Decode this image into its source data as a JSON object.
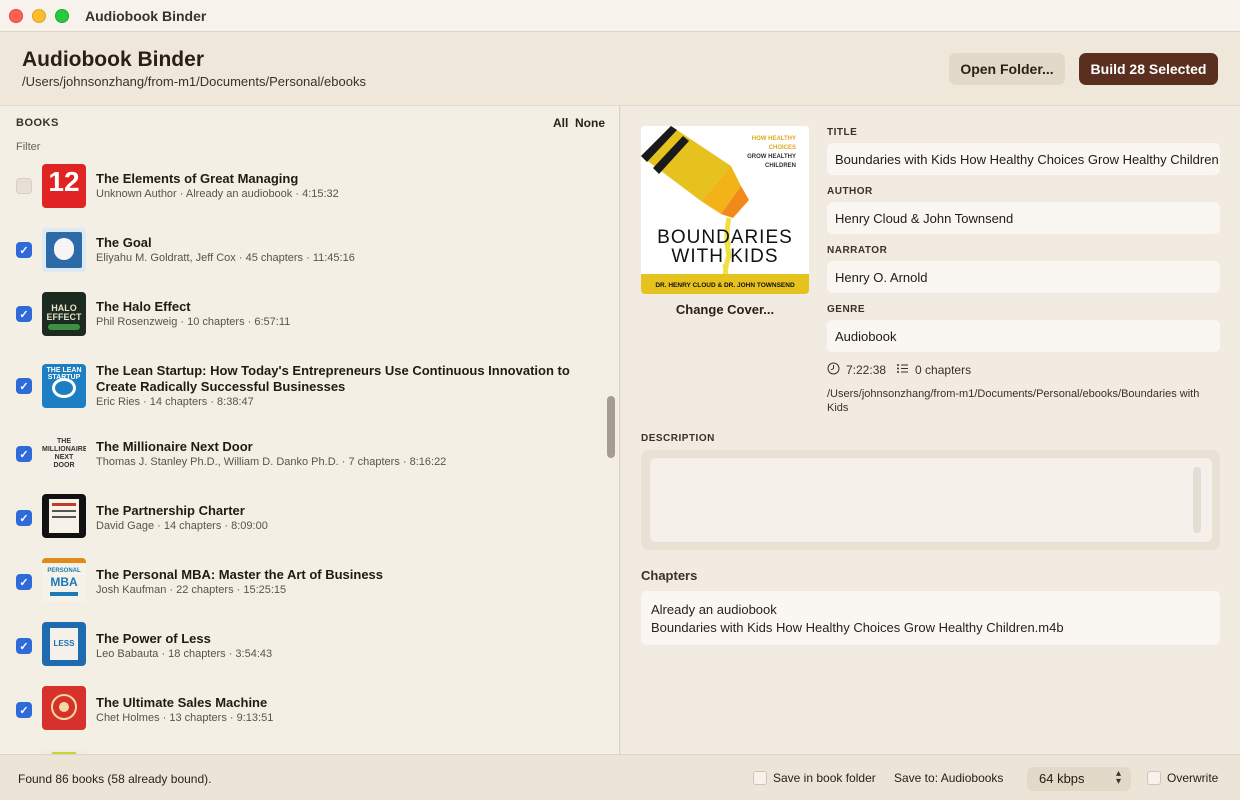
{
  "window": {
    "title": "Audiobook Binder"
  },
  "header": {
    "title": "Audiobook Binder",
    "path": "/Users/johnsonzhang/from-m1/Documents/Personal/ebooks",
    "open_folder_label": "Open Folder...",
    "build_label": "Build 28 Selected"
  },
  "books_panel": {
    "heading": "BOOKS",
    "all_label": "All",
    "none_label": "None",
    "filter_placeholder": "Filter",
    "items": [
      {
        "title": "The Elements of Great Managing",
        "meta": "Unknown Author  ·  Already an audiobook  ·  4:15:32",
        "checked": false
      },
      {
        "title": "The Goal",
        "meta": "Eliyahu M. Goldratt, Jeff Cox  ·  45 chapters  ·  11:45:16",
        "checked": true
      },
      {
        "title": "The Halo Effect",
        "meta": "Phil Rosenzweig  ·  10 chapters  ·  6:57:11",
        "checked": true
      },
      {
        "title": "The Lean Startup: How Today's Entrepreneurs Use Continuous Innovation to Create Radically Successful Businesses",
        "meta": "Eric Ries  ·  14 chapters  ·  8:38:47",
        "checked": true
      },
      {
        "title": "The Millionaire Next Door",
        "meta": "Thomas J. Stanley Ph.D., William D. Danko Ph.D.  ·  7 chapters  ·  8:16:22",
        "checked": true
      },
      {
        "title": "The Partnership Charter",
        "meta": "David Gage  ·  14 chapters  ·  8:09:00",
        "checked": true
      },
      {
        "title": "The Personal MBA: Master the Art of Business",
        "meta": "Josh Kaufman  ·  22 chapters  ·  15:25:15",
        "checked": true
      },
      {
        "title": "The Power of Less",
        "meta": "Leo Babauta  ·  18 chapters  ·  3:54:43",
        "checked": true
      },
      {
        "title": "The Ultimate Sales Machine",
        "meta": "Chet Holmes  ·  13 chapters  ·  9:13:51",
        "checked": true
      }
    ]
  },
  "detail": {
    "cover": {
      "tagline_1": "HOW HEALTHY",
      "tagline_2": "CHOICES",
      "tagline_3": "GROW HEALTHY",
      "tagline_4": "CHILDREN",
      "title_line_1": "BOUNDARIES",
      "title_line_2": "WITH KIDS",
      "authors": "DR. HENRY CLOUD & DR. JOHN TOWNSEND"
    },
    "change_cover_label": "Change Cover...",
    "title_label": "TITLE",
    "title_value": "Boundaries with Kids How Healthy Choices Grow Healthy Children",
    "author_label": "AUTHOR",
    "author_value": "Henry Cloud & John Townsend",
    "narrator_label": "NARRATOR",
    "narrator_value": "Henry O. Arnold",
    "genre_label": "GENRE",
    "genre_value": "Audiobook",
    "duration": "7:22:38",
    "chapters_count": "0 chapters",
    "file_path": "/Users/johnsonzhang/from-m1/Documents/Personal/ebooks/Boundaries with Kids",
    "description_label": "DESCRIPTION",
    "chapters_label": "Chapters",
    "chapters_line_1": "Already an audiobook",
    "chapters_line_2": "Boundaries with Kids How Healthy Choices Grow Healthy Children.m4b"
  },
  "footer": {
    "status": "Found 86 books (58 already bound).",
    "save_in_folder_label": "Save in book folder",
    "save_to_label": "Save to: Audiobooks",
    "bitrate_value": "64 kbps",
    "overwrite_label": "Overwrite"
  }
}
